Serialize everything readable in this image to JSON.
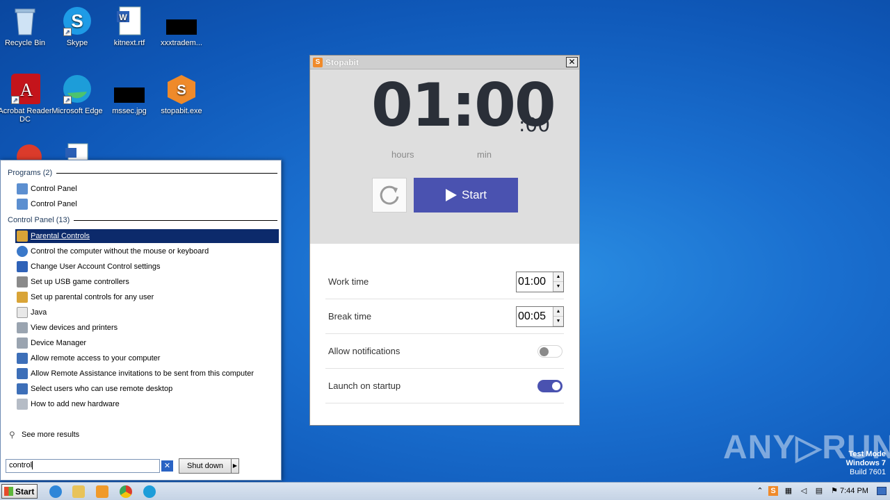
{
  "desktop": {
    "icons": [
      {
        "label": "Recycle Bin",
        "icon": "recycle-bin-icon"
      },
      {
        "label": "Skype",
        "icon": "skype-icon"
      },
      {
        "label": "kitnext.rtf",
        "icon": "word-doc-icon"
      },
      {
        "label": "xxxtradem...",
        "icon": "black-file-icon"
      },
      {
        "label": "Acrobat Reader DC",
        "icon": "acrobat-icon"
      },
      {
        "label": "Microsoft Edge",
        "icon": "edge-icon"
      },
      {
        "label": "mssec.jpg",
        "icon": "black-file-icon"
      },
      {
        "label": "stopabit.exe",
        "icon": "stopabit-package-icon"
      }
    ]
  },
  "start_menu": {
    "programs_header": "Programs (2)",
    "programs": [
      "Control Panel",
      "Control Panel"
    ],
    "control_panel_header": "Control Panel (13)",
    "control_panel_items": [
      "Parental Controls",
      "Control the computer without the mouse or keyboard",
      "Change User Account Control settings",
      "Set up USB game controllers",
      "Set up parental controls for any user",
      "Java",
      "View devices and printers",
      "Device Manager",
      "Allow remote access to your computer",
      "Allow Remote Assistance invitations to be sent from this computer",
      "Select users who can use remote desktop",
      "How to add new hardware"
    ],
    "see_more": "See more results",
    "search_value": "control",
    "shutdown_label": "Shut down"
  },
  "stopabit": {
    "title": "Stopabit",
    "logo_letter": "S",
    "close_label": "✕",
    "time_main": "01:00",
    "time_seconds": ":00",
    "label_hours": "hours",
    "label_min": "min",
    "start_label": "Start",
    "settings": {
      "work_time_label": "Work time",
      "work_time_value": "01:00",
      "break_time_label": "Break time",
      "break_time_value": "00:05",
      "notifications_label": "Allow notifications",
      "notifications_on": false,
      "startup_label": "Launch on startup",
      "startup_on": true
    },
    "accent_color": "#4a52b0"
  },
  "watermark": "ANY▷RUN",
  "test_mode": {
    "line1": "Test Mode",
    "line2": "Windows 7",
    "line3": "Build 7601"
  },
  "taskbar": {
    "start_label": "Start",
    "clock": "7:44 PM"
  }
}
